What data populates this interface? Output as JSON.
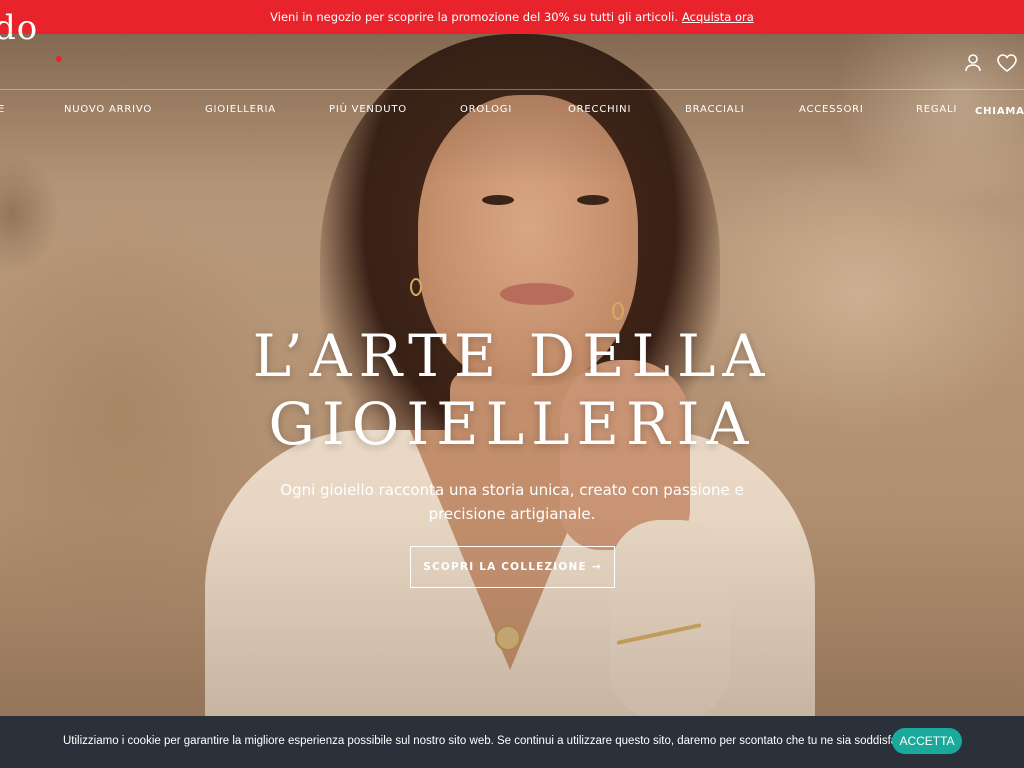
{
  "promo": {
    "text": "Vieni in negozio per scoprire la promozione del 30% su tutti gli articoli.",
    "link": "Acquista ora"
  },
  "header": {
    "logo": "do",
    "icons": [
      "user-icon",
      "heart-icon"
    ]
  },
  "nav": {
    "items": [
      "E",
      "NUOVO ARRIVO",
      "GIOIELLERIA",
      "PIÙ VENDUTO",
      "OROLOGI",
      "ORECCHINI",
      "BRACCIALI",
      "ACCESSORI",
      "REGALI",
      "CHIAMA C"
    ]
  },
  "hero": {
    "headline_line1": "L’ARTE DELLA",
    "headline_line2": "GIOIELLERIA",
    "subtext": "Ogni gioiello racconta una storia unica, creato con passione e precisione artigianale.",
    "cta": "SCOPRI LA COLLEZIONE →"
  },
  "cookie": {
    "text": "Utilizziamo i cookie per garantire la migliore esperienza possibile sul nostro sito web. Se continui a utilizzare questo sito, daremo per scontato che tu ne sia soddisfatto.",
    "button": "ACCETTA"
  },
  "colors": {
    "promo_bg": "#e8232b",
    "cookie_bg": "#2b313b",
    "accept_bg": "#1ba99b"
  }
}
